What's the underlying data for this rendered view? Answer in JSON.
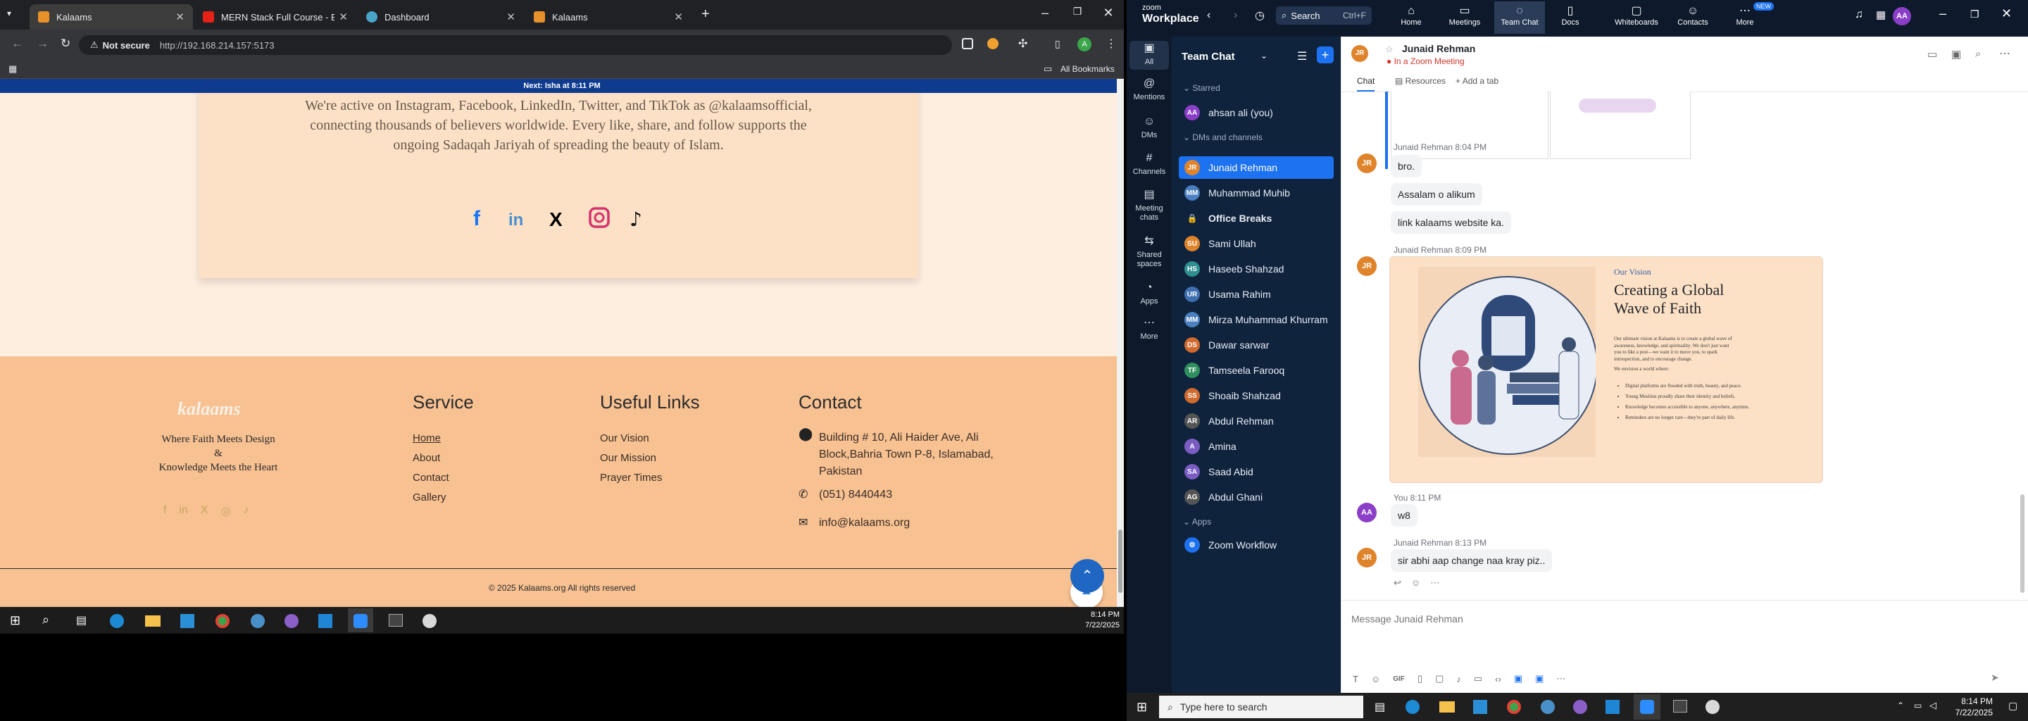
{
  "browser": {
    "tabs": [
      {
        "title": "Kalaams"
      },
      {
        "title": "MERN Stack Full Course - ECom"
      },
      {
        "title": "Dashboard"
      },
      {
        "title": "Kalaams"
      }
    ],
    "not_secure": "Not secure",
    "url": "http://192.168.214.157:5173",
    "all_bookmarks": "All Bookmarks"
  },
  "site": {
    "banner": "Next: Isha at 8:11 PM",
    "intro_lines": [
      "We're active on Instagram, Facebook, LinkedIn, Twitter, and TikTok as @kalaamsofficial,",
      "connecting thousands of believers worldwide. Every like, share, and follow supports the",
      "ongoing Sadaqah Jariyah of spreading the beauty of Islam."
    ],
    "logo": "kalaams",
    "tagline": [
      "Where Faith Meets Design",
      "&",
      "Knowledge Meets the Heart"
    ],
    "service": {
      "heading": "Service",
      "links": [
        "Home",
        "About",
        "Contact",
        "Gallery"
      ]
    },
    "useful": {
      "heading": "Useful Links",
      "links": [
        "Our Vision",
        "Our Mission",
        "Prayer Times"
      ]
    },
    "contact": {
      "heading": "Contact",
      "address_lines": [
        "Building # 10, Ali Haider Ave, Ali",
        "Block,Bahria Town P-8, Islamabad,",
        "Pakistan"
      ],
      "phone": "(051) 8440443",
      "email": "info@kalaams.org"
    },
    "copyright": "© 2025 Kalaams.org All rights reserved"
  },
  "taskbar_left": {
    "time": "8:14 PM",
    "date": "7/22/2025"
  },
  "zoom": {
    "brand_top": "zoom",
    "brand": "Workplace",
    "search": "Search",
    "search_shortcut": "Ctrl+F",
    "nav": [
      "Home",
      "Meetings",
      "Team Chat",
      "Docs",
      "Whiteboards",
      "Contacts",
      "More"
    ],
    "new_badge": "NEW",
    "user_initials": "AA",
    "side": [
      "All",
      "Mentions",
      "DMs",
      "Channels",
      "Meeting chats",
      "Shared spaces",
      "Apps",
      "More"
    ],
    "panel_title": "Team Chat",
    "starred": "Starred",
    "self": "ahsan ali (you)",
    "dms_header": "DMs and channels",
    "contacts": [
      {
        "name": "Junaid Rehman",
        "ini": "JR",
        "color": "#e0842c"
      },
      {
        "name": "Muhammad Muhib",
        "ini": "MM",
        "color": "#4a7fc1"
      },
      {
        "name": "Office Breaks",
        "ini": "",
        "color": "#10233c"
      },
      {
        "name": "Sami Ullah",
        "ini": "SU",
        "color": "#e0842c"
      },
      {
        "name": "Haseeb Shahzad",
        "ini": "HS",
        "color": "#2f8f8f"
      },
      {
        "name": "Usama Rahim",
        "ini": "UR",
        "color": "#3f6fb0"
      },
      {
        "name": "Mirza Muhammad Khurram",
        "ini": "MM",
        "color": "#4a7fc1"
      },
      {
        "name": "Dawar sarwar",
        "ini": "DS",
        "color": "#d06a2e"
      },
      {
        "name": "Tamseela Farooq",
        "ini": "TF",
        "color": "#2f8f5f"
      },
      {
        "name": "Shoaib Shahzad",
        "ini": "SS",
        "color": "#d06a2e"
      },
      {
        "name": "Abdul Rehman",
        "ini": "AR",
        "color": "#555"
      },
      {
        "name": "Amina",
        "ini": "A",
        "color": "#7b5cc2"
      },
      {
        "name": "Saad Abid",
        "ini": "SA",
        "color": "#7b5cc2"
      },
      {
        "name": "Abdul Ghani",
        "ini": "AG",
        "color": "#555"
      }
    ],
    "apps_header": "Apps",
    "app": "Zoom Workflow",
    "chat_name": "Junaid Rehman",
    "chat_status": "In a Zoom Meeting",
    "chat_tabs": [
      "Chat",
      "Resources",
      "Add a tab"
    ],
    "messages": [
      {
        "meta": "Junaid Rehman 8:04 PM",
        "texts": [
          "bro.",
          "Assalam o alikum",
          "link kalaams website ka."
        ]
      },
      {
        "meta": "Junaid Rehman 8:09 PM"
      },
      {
        "meta": "You 8:11 PM",
        "texts": [
          "w8"
        ]
      },
      {
        "meta": "Junaid Rehman 8:13 PM",
        "texts": [
          "sir abhi aap change naa kray piz.."
        ]
      }
    ],
    "shared": {
      "label": "Our Vision",
      "title_lines": [
        "Creating a Global",
        "Wave of Faith"
      ],
      "para": [
        "Our ultimate vision at Kalaams is to create a global wave of",
        "awareness, knowledge, and spirituality. We don't just want",
        "you to like a post—we want it to move you, to spark",
        "introspection, and to encourage change."
      ],
      "sub": "We envision a world where:",
      "bullets": [
        "Digital platforms are flooded with truth, beauty, and peace.",
        "Young Muslims proudly share their identity and beliefs.",
        "Knowledge becomes accessible to anyone, anywhere, anytime.",
        "Reminders are no longer rare—they're part of daily life."
      ]
    },
    "composer_placeholder": "Message Junaid Rehman",
    "taskbar": {
      "search": "Type here to search",
      "time": "8:14 PM",
      "date": "7/22/2025"
    }
  }
}
